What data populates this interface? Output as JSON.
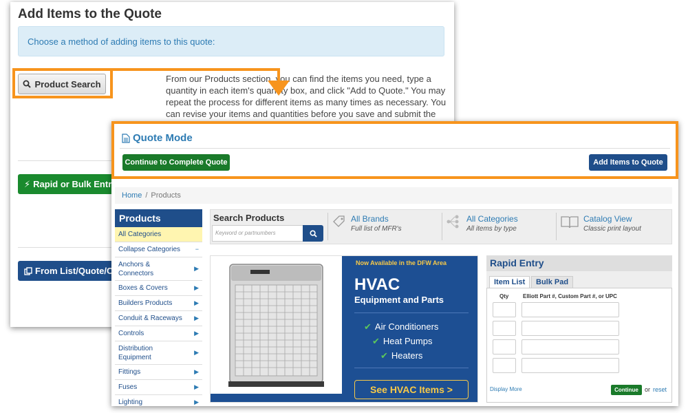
{
  "back_panel": {
    "title": "Add Items to the Quote",
    "info": "Choose a method of adding items to this quote:",
    "product_search_label": "Product Search",
    "description": "From our Products section, you can find the items you need, type a quantity in each item's quantity box, and click \"Add to Quote.\" You may repeat the process for different items as many times as necessary. You can revise your items and quantities before you save and submit the",
    "rapid_bulk_label": "Rapid or Bulk Entry",
    "from_list_label": "From List/Quote/O"
  },
  "quote_mode": {
    "title": "Quote Mode",
    "continue_label": "Continue to Complete Quote",
    "add_items_label": "Add Items to Quote"
  },
  "breadcrumb": {
    "home": "Home",
    "separator": "/",
    "current": "Products"
  },
  "sidebar": {
    "title": "Products",
    "items": [
      {
        "label": "All Categories",
        "marker": ""
      },
      {
        "label": "Collapse Categories",
        "marker": "−"
      },
      {
        "label": "Anchors & Connectors",
        "marker": "▶"
      },
      {
        "label": "Boxes & Covers",
        "marker": "▶"
      },
      {
        "label": "Builders Products",
        "marker": "▶"
      },
      {
        "label": "Conduit & Raceways",
        "marker": "▶"
      },
      {
        "label": "Controls",
        "marker": "▶"
      },
      {
        "label": "Distribution Equipment",
        "marker": "▶"
      },
      {
        "label": "Fittings",
        "marker": "▶"
      },
      {
        "label": "Fuses",
        "marker": "▶"
      },
      {
        "label": "Lighting",
        "marker": "▶"
      }
    ]
  },
  "search": {
    "title": "Search Products",
    "placeholder": "Keyword or partnumbers",
    "links": [
      {
        "title": "All Brands",
        "subtitle": "Full list of MFR's",
        "icon": "tag-icon"
      },
      {
        "title": "All Categories",
        "subtitle": "All items by type",
        "icon": "category-tree-icon"
      },
      {
        "title": "Catalog View",
        "subtitle": "Classic print layout",
        "icon": "book-icon"
      }
    ]
  },
  "banner": {
    "now_available": "Now Available in the DFW Area",
    "headline": "HVAC",
    "subheadline": "Equipment and Parts",
    "items": [
      "Air Conditioners",
      "Heat Pumps",
      "Heaters"
    ],
    "cta": "See HVAC Items >"
  },
  "rapid_entry": {
    "title": "Rapid Entry",
    "tabs": [
      "Item List",
      "Bulk Pad"
    ],
    "qty_header": "Qty",
    "part_header": "Elliott Part #, Custom Part #, or UPC",
    "display_more": "Display More",
    "continue_label": "Continue",
    "or_text": "or",
    "reset_label": "reset"
  },
  "colors": {
    "accent_orange": "#f7941d",
    "navy": "#1f4e8a",
    "green": "#1a7a2a",
    "link_blue": "#2d7bb3",
    "banner_blue": "#1d4f93",
    "banner_yellow": "#f7c948"
  }
}
